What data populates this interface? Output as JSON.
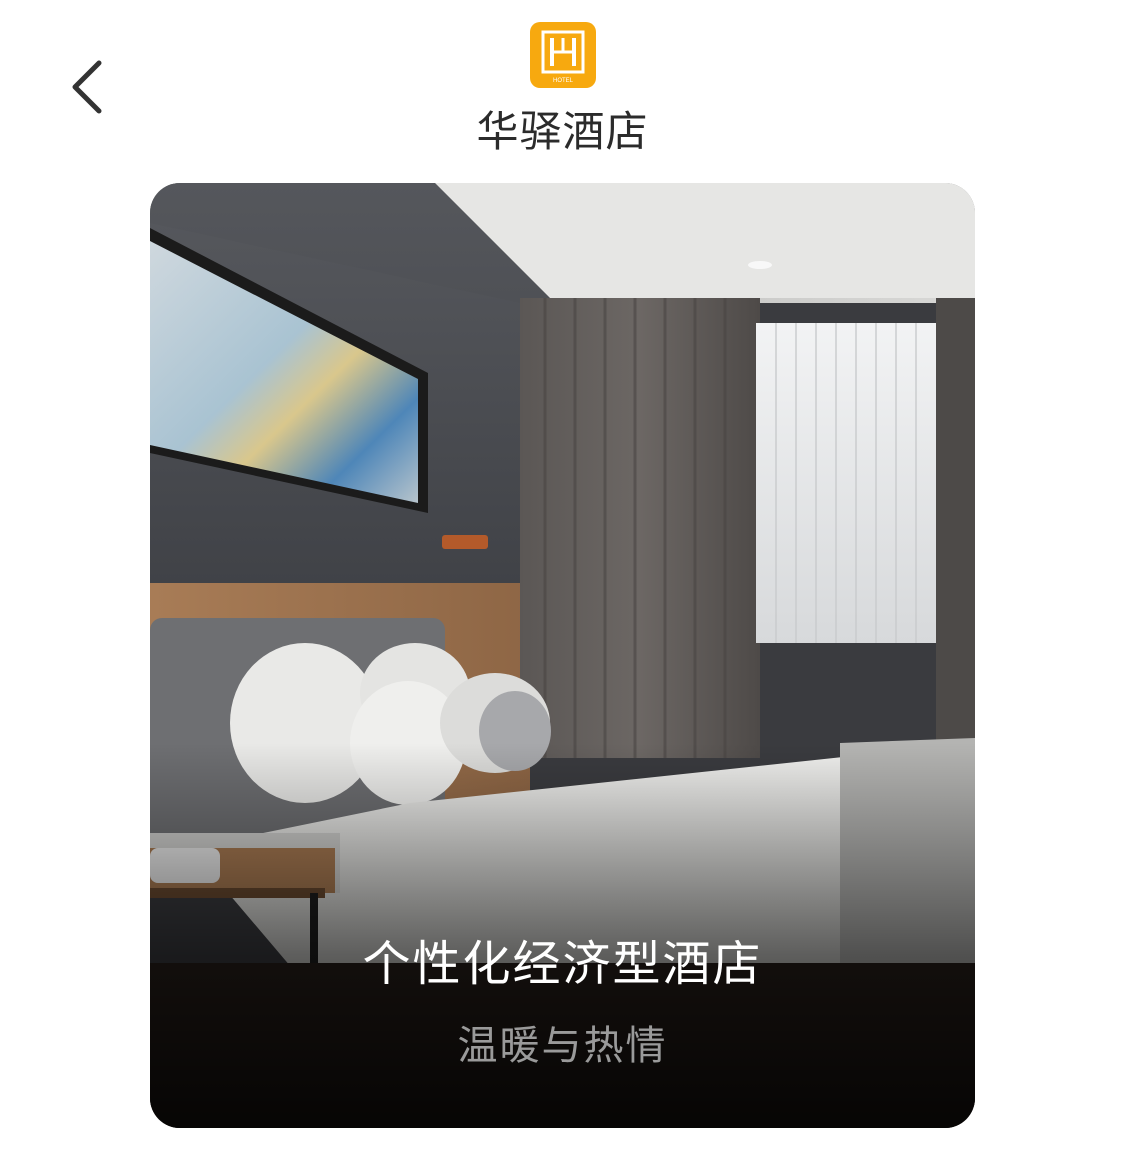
{
  "header": {
    "back_icon": "chevron-left-icon",
    "logo_text": "HOTEL",
    "brand_name": "华驿酒店",
    "brand_color": "#f7a90f"
  },
  "hero": {
    "title": "个性化经济型酒店",
    "subtitle": "温暖与热情"
  }
}
